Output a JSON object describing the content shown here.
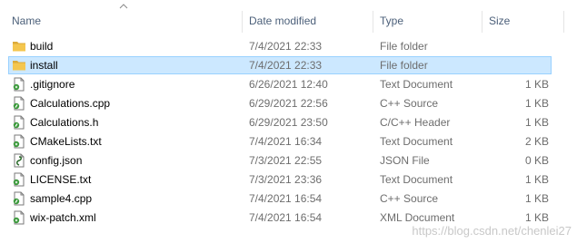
{
  "columns": {
    "name": "Name",
    "date": "Date modified",
    "type": "Type",
    "size": "Size"
  },
  "files": [
    {
      "name": "build",
      "date": "7/4/2021 22:33",
      "type": "File folder",
      "size": "",
      "icon": "folder-icon",
      "selected": false
    },
    {
      "name": "install",
      "date": "7/4/2021 22:33",
      "type": "File folder",
      "size": "",
      "icon": "folder-icon",
      "selected": true
    },
    {
      "name": ".gitignore",
      "date": "6/26/2021 12:40",
      "type": "Text Document",
      "size": "1 KB",
      "icon": "text-file-icon",
      "selected": false
    },
    {
      "name": "Calculations.cpp",
      "date": "6/29/2021 22:56",
      "type": "C++ Source",
      "size": "1 KB",
      "icon": "code-file-icon",
      "selected": false
    },
    {
      "name": "Calculations.h",
      "date": "6/29/2021 23:50",
      "type": "C/C++ Header",
      "size": "1 KB",
      "icon": "code-file-icon",
      "selected": false
    },
    {
      "name": "CMakeLists.txt",
      "date": "7/4/2021 16:34",
      "type": "Text Document",
      "size": "2 KB",
      "icon": "text-file-icon",
      "selected": false
    },
    {
      "name": "config.json",
      "date": "7/3/2021 22:55",
      "type": "JSON File",
      "size": "0 KB",
      "icon": "json-file-icon",
      "selected": false
    },
    {
      "name": "LICENSE.txt",
      "date": "7/3/2021 23:36",
      "type": "Text Document",
      "size": "1 KB",
      "icon": "text-file-icon",
      "selected": false
    },
    {
      "name": "sample4.cpp",
      "date": "7/4/2021 16:54",
      "type": "C++ Source",
      "size": "1 KB",
      "icon": "code-file-icon",
      "selected": false
    },
    {
      "name": "wix-patch.xml",
      "date": "7/4/2021 16:54",
      "type": "XML Document",
      "size": "1 KB",
      "icon": "text-file-icon",
      "selected": false
    }
  ],
  "watermark": "https://blog.csdn.net/chenlei27",
  "colors": {
    "selection": "#cce8ff",
    "selection_border": "#99d1ff",
    "folder": "#f4c64e",
    "file_icon_accent": "#3c9a3c"
  }
}
